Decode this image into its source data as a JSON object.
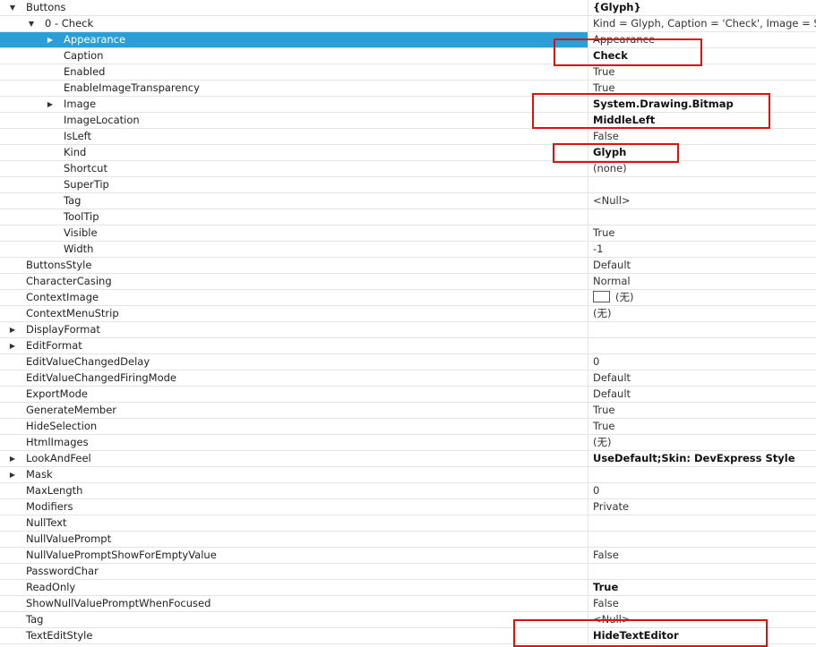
{
  "colors": {
    "selection": "#2a9fd6",
    "highlight_box": "#e01010",
    "grid_line": "#e4e4e4"
  },
  "properties": [
    {
      "name": "Buttons",
      "value": "{Glyph}",
      "bold": true,
      "level": 0,
      "arrow": "expanded"
    },
    {
      "name": "0 - Check",
      "value": "Kind = Glyph, Caption = 'Check', Image = Sys",
      "bold": false,
      "level": 1,
      "arrow": "expanded"
    },
    {
      "name": "Appearance",
      "value": "Appearance",
      "bold": false,
      "level": 2,
      "arrow": "collapsed",
      "selected": true
    },
    {
      "name": "Caption",
      "value": "Check",
      "bold": true,
      "level": 2
    },
    {
      "name": "Enabled",
      "value": "True",
      "bold": false,
      "level": 2
    },
    {
      "name": "EnableImageTransparency",
      "value": "True",
      "bold": false,
      "level": 2
    },
    {
      "name": "Image",
      "value": "System.Drawing.Bitmap",
      "bold": true,
      "level": 2,
      "arrow": "collapsed"
    },
    {
      "name": "ImageLocation",
      "value": "MiddleLeft",
      "bold": true,
      "level": 2
    },
    {
      "name": "IsLeft",
      "value": "False",
      "bold": false,
      "level": 2
    },
    {
      "name": "Kind",
      "value": "Glyph",
      "bold": true,
      "level": 2
    },
    {
      "name": "Shortcut",
      "value": "(none)",
      "bold": false,
      "level": 2
    },
    {
      "name": "SuperTip",
      "value": "",
      "bold": false,
      "level": 2
    },
    {
      "name": "Tag",
      "value": "<Null>",
      "bold": false,
      "level": 2
    },
    {
      "name": "ToolTip",
      "value": "",
      "bold": false,
      "level": 2
    },
    {
      "name": "Visible",
      "value": "True",
      "bold": false,
      "level": 2
    },
    {
      "name": "Width",
      "value": "-1",
      "bold": false,
      "level": 2
    },
    {
      "name": "ButtonsStyle",
      "value": "Default",
      "bold": false,
      "level": 0
    },
    {
      "name": "CharacterCasing",
      "value": "Normal",
      "bold": false,
      "level": 0
    },
    {
      "name": "ContextImage",
      "value": "(无)",
      "bold": false,
      "level": 0,
      "swatch": true
    },
    {
      "name": "ContextMenuStrip",
      "value": "(无)",
      "bold": false,
      "level": 0
    },
    {
      "name": "DisplayFormat",
      "value": "",
      "bold": false,
      "level": 0,
      "arrow": "collapsed"
    },
    {
      "name": "EditFormat",
      "value": "",
      "bold": false,
      "level": 0,
      "arrow": "collapsed"
    },
    {
      "name": "EditValueChangedDelay",
      "value": "0",
      "bold": false,
      "level": 0
    },
    {
      "name": "EditValueChangedFiringMode",
      "value": "Default",
      "bold": false,
      "level": 0
    },
    {
      "name": "ExportMode",
      "value": "Default",
      "bold": false,
      "level": 0
    },
    {
      "name": "GenerateMember",
      "value": "True",
      "bold": false,
      "level": 0
    },
    {
      "name": "HideSelection",
      "value": "True",
      "bold": false,
      "level": 0
    },
    {
      "name": "HtmlImages",
      "value": "(无)",
      "bold": false,
      "level": 0
    },
    {
      "name": "LookAndFeel",
      "value": "UseDefault;Skin: DevExpress Style",
      "bold": true,
      "level": 0,
      "arrow": "collapsed"
    },
    {
      "name": "Mask",
      "value": "",
      "bold": false,
      "level": 0,
      "arrow": "collapsed"
    },
    {
      "name": "MaxLength",
      "value": "0",
      "bold": false,
      "level": 0
    },
    {
      "name": "Modifiers",
      "value": "Private",
      "bold": false,
      "level": 0
    },
    {
      "name": "NullText",
      "value": "",
      "bold": false,
      "level": 0
    },
    {
      "name": "NullValuePrompt",
      "value": "",
      "bold": false,
      "level": 0
    },
    {
      "name": "NullValuePromptShowForEmptyValue",
      "value": "False",
      "bold": false,
      "level": 0
    },
    {
      "name": "PasswordChar",
      "value": "",
      "bold": false,
      "level": 0
    },
    {
      "name": "ReadOnly",
      "value": "True",
      "bold": true,
      "level": 0
    },
    {
      "name": "ShowNullValuePromptWhenFocused",
      "value": "False",
      "bold": false,
      "level": 0
    },
    {
      "name": "Tag",
      "value": "<Null>",
      "bold": false,
      "level": 0
    },
    {
      "name": "TextEditStyle",
      "value": "HideTextEditor",
      "bold": true,
      "level": 0
    }
  ]
}
